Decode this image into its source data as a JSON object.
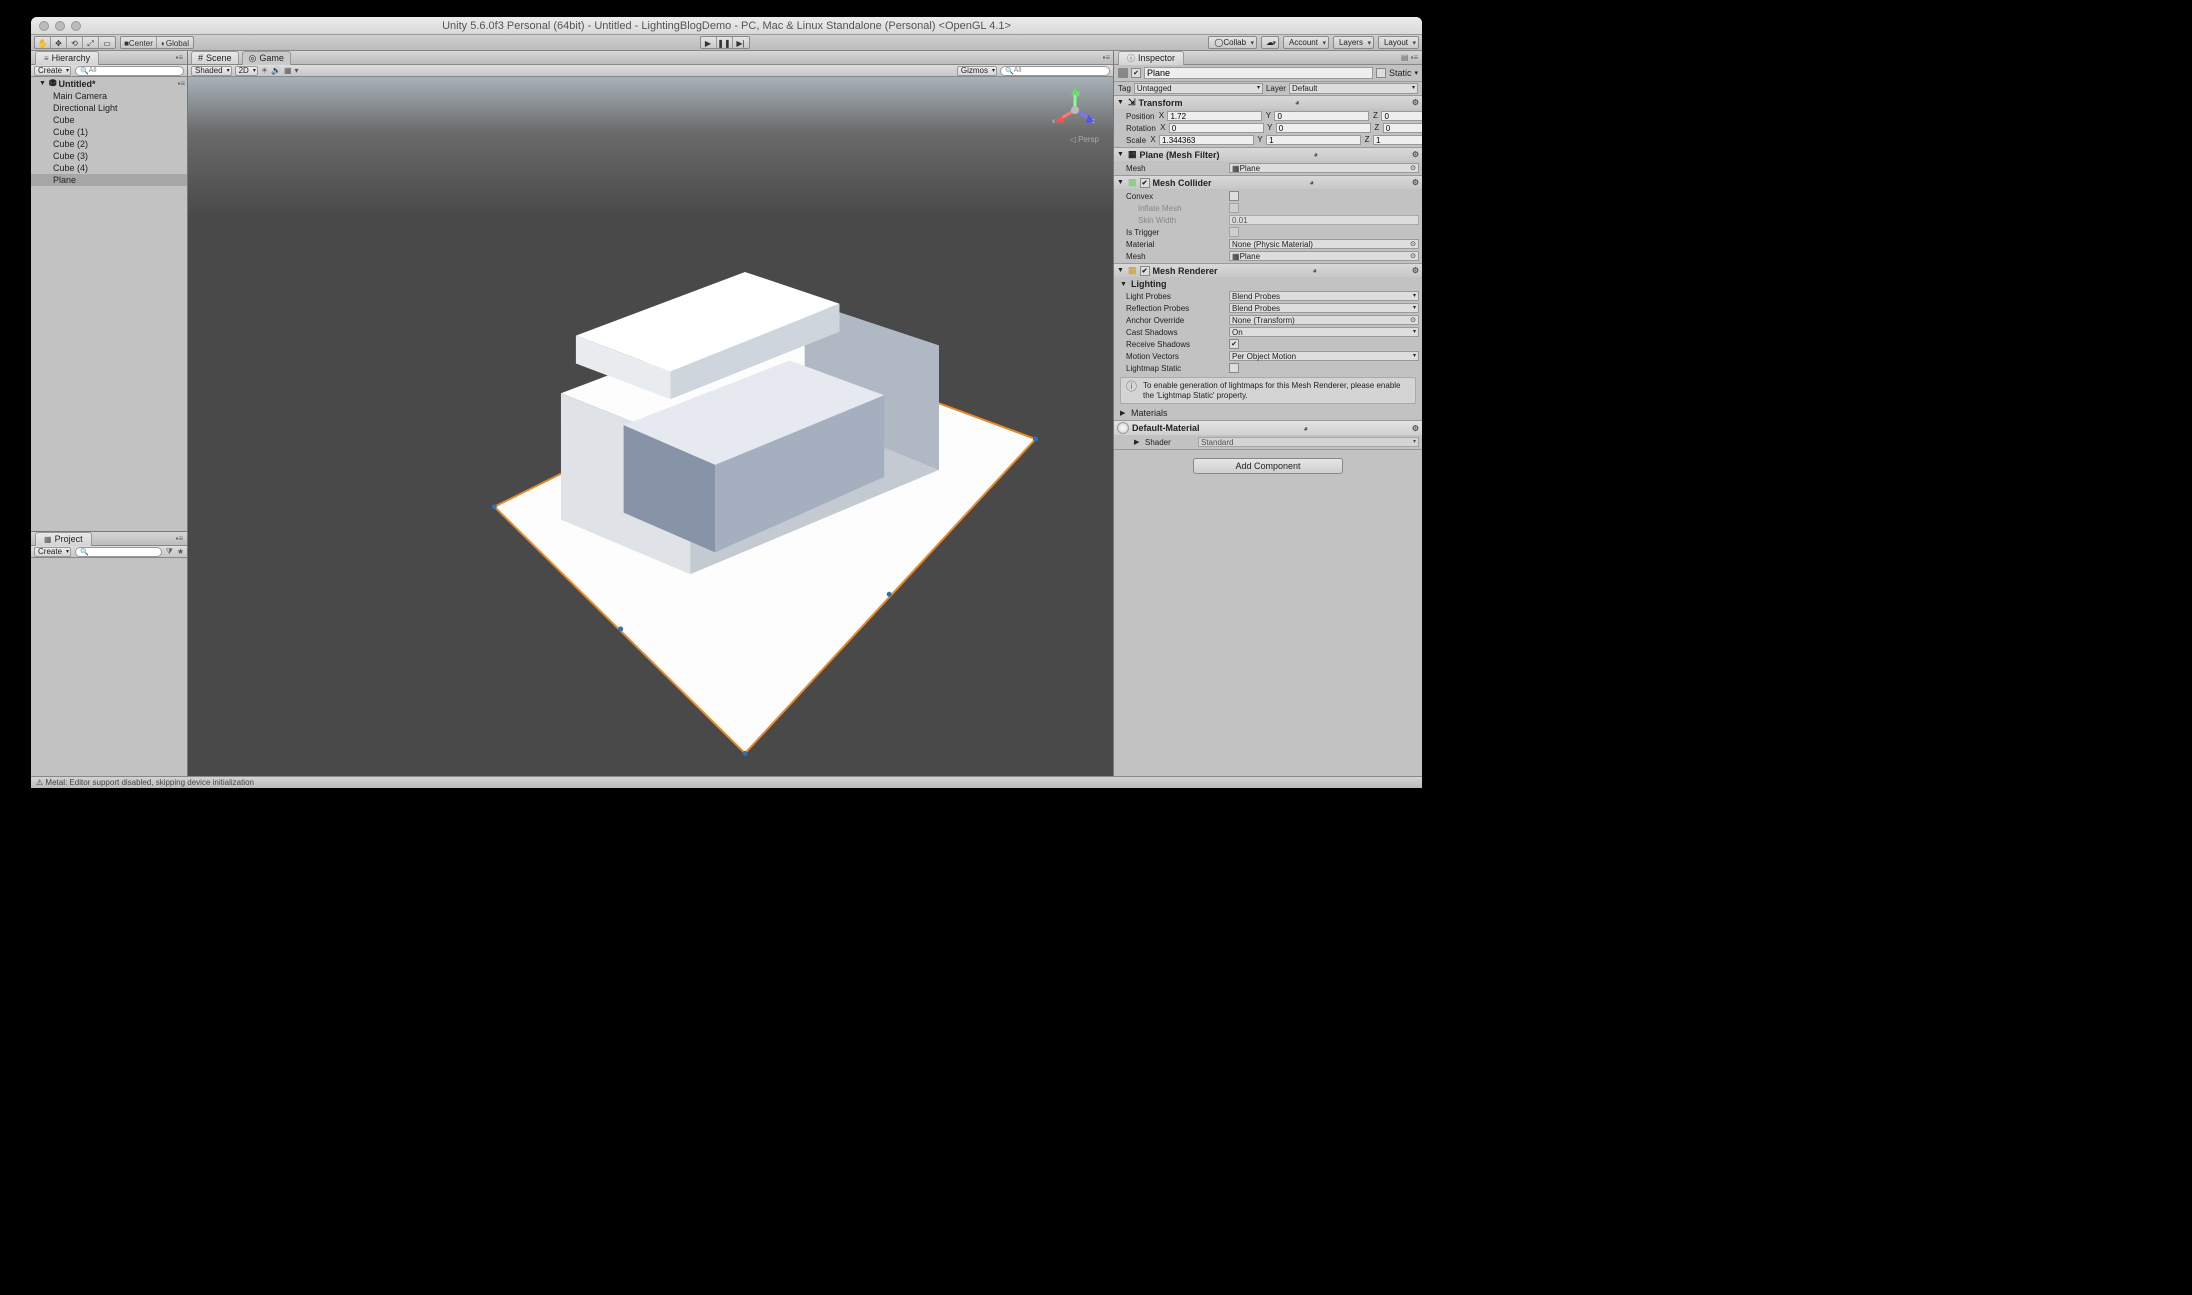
{
  "title": "Unity 5.6.0f3 Personal (64bit) - Untitled - LightingBlogDemo - PC, Mac & Linux Standalone (Personal) <OpenGL 4.1>",
  "toolbar": {
    "center_label": "Center",
    "global_label": "Global",
    "collab_label": "Collab",
    "account_label": "Account",
    "layers_label": "Layers",
    "layout_label": "Layout"
  },
  "hierarchy": {
    "title": "Hierarchy",
    "create": "Create",
    "q_all": "All",
    "scene_name": "Untitled*",
    "items": [
      "Main Camera",
      "Directional Light",
      "Cube",
      "Cube (1)",
      "Cube (2)",
      "Cube (3)",
      "Cube (4)",
      "Plane"
    ]
  },
  "project": {
    "title": "Project",
    "create": "Create"
  },
  "scene": {
    "tab_scene": "Scene",
    "tab_game": "Game",
    "shaded": "Shaded",
    "twoD": "2D",
    "gizmos": "Gizmos",
    "q_all": "All",
    "persp": "Persp"
  },
  "inspector": {
    "title": "Inspector",
    "obj_name": "Plane",
    "static": "Static",
    "tag_label": "Tag",
    "tag_value": "Untagged",
    "layer_label": "Layer",
    "layer_value": "Default",
    "transform": {
      "title": "Transform",
      "position": {
        "label": "Position",
        "x": "1.72",
        "y": "0",
        "z": "0"
      },
      "rotation": {
        "label": "Rotation",
        "x": "0",
        "y": "0",
        "z": "0"
      },
      "scale": {
        "label": "Scale",
        "x": "1.344363",
        "y": "1",
        "z": "1"
      }
    },
    "mesh_filter": {
      "title": "Plane (Mesh Filter)",
      "mesh_label": "Mesh",
      "mesh_value": "Plane"
    },
    "mesh_collider": {
      "title": "Mesh Collider",
      "convex": "Convex",
      "inflate": "Inflate Mesh",
      "skin_width_label": "Skin Width",
      "skin_width_value": "0.01",
      "is_trigger": "Is Trigger",
      "material_label": "Material",
      "material_value": "None (Physic Material)",
      "mesh_label": "Mesh",
      "mesh_value": "Plane"
    },
    "mesh_renderer": {
      "title": "Mesh Renderer",
      "lighting": "Lighting",
      "light_probes_label": "Light Probes",
      "light_probes_value": "Blend Probes",
      "reflection_probes_label": "Reflection Probes",
      "reflection_probes_value": "Blend Probes",
      "anchor_label": "Anchor Override",
      "anchor_value": "None (Transform)",
      "cast_shadows_label": "Cast Shadows",
      "cast_shadows_value": "On",
      "receive_shadows": "Receive Shadows",
      "motion_vectors_label": "Motion Vectors",
      "motion_vectors_value": "Per Object Motion",
      "lightmap_static": "Lightmap Static",
      "info": "To enable generation of lightmaps for this Mesh Renderer, please enable the 'Lightmap Static' property.",
      "materials": "Materials"
    },
    "material": {
      "title": "Default-Material",
      "shader_label": "Shader",
      "shader_value": "Standard"
    },
    "add_component": "Add Component"
  },
  "statusbar": "Metal: Editor support disabled, skipping device initialization"
}
